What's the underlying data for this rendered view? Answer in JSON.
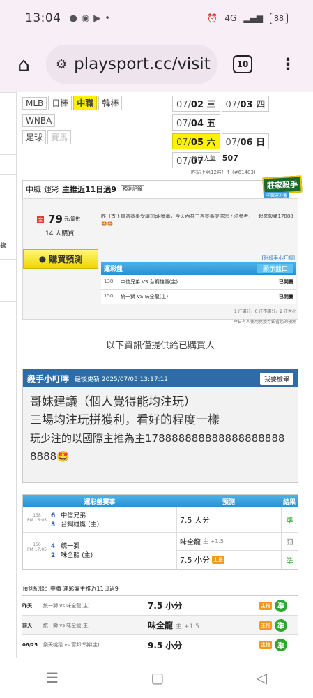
{
  "status": {
    "time": "13:04",
    "battery": "88",
    "net": "4G"
  },
  "browser": {
    "url": "playsport.cc/visit",
    "tab_count": "10"
  },
  "leagues": {
    "row1": [
      "MLB",
      "日棒",
      "中職",
      "韓棒"
    ],
    "row2": [
      "WNBA"
    ],
    "row3": [
      "足球",
      "賽馬"
    ],
    "active": "中職"
  },
  "dates": [
    {
      "m": "07/",
      "d": "02 三"
    },
    {
      "m": "07/",
      "d": "03 四"
    },
    {
      "m": "07/",
      "d": "04 五"
    },
    {
      "m": "07/",
      "d": "05 六"
    },
    {
      "m": "07/",
      "d": "06 日"
    },
    {
      "m": "07/",
      "d": "07 一"
    }
  ],
  "visits": {
    "label": "今日人氣",
    "value": "507",
    "sub": "昨站上第12名！↑ (#61483)"
  },
  "card": {
    "league": "中職",
    "type": "運彩",
    "title": "主推近11日過9",
    "record_btn": "預測記錄",
    "badge": "莊家殺手",
    "badge_sub": "中職運彩盤",
    "price_num": "79",
    "price_unit": "元/篇數",
    "buyers": "14",
    "buyers_unit": "人購買",
    "desc": "昨日首下單週賽事受讓加pk獲贏，今天內共三週賽事提供您下注參考，一起來殺豬17888🤩🤩",
    "buy_btn": "購買預測",
    "pm_link": "[附殺手小叮嚀]",
    "mini_header": "運彩盤",
    "mini_btn": "顯示盤口",
    "mini_rows": [
      {
        "no": "138",
        "match": "中信兄弟 VS 台鋼雄鷹(主)",
        "status": "已開賽"
      },
      {
        "no": "150",
        "match": "統一獅 VS 味全龍(主)",
        "status": "已開賽"
      }
    ],
    "mini_note": "1 注讓分，0 注不讓分，2 注大小",
    "mini_note2": "今日有人使用兌換券觀看您的預測"
  },
  "notice": "以下資訊僅提供給已購買人",
  "tips": {
    "title": "殺手小叮嚀",
    "updated": "最後更新 2025/07/05 13:17:12",
    "report_btn": "我要檢舉",
    "lines": [
      "哥妹建議（個人覺得能均注玩）",
      "三場均注玩拼獲利，看好的程度一樣",
      "玩少注的以國際主推為主1788888888888888888888888🤩"
    ]
  },
  "games_table": {
    "headers": [
      "運彩盤賽事",
      "預測",
      "結果"
    ],
    "rows": [
      {
        "no": "138",
        "time": "PM 16:05",
        "s1": "6",
        "t1": "中信兄弟",
        "s2": "3",
        "t2": "台鋼雄鷹 (主)",
        "pick": "7.5 大分",
        "result": "準"
      },
      {
        "no": "150",
        "time": "PM 17:05",
        "s1": "4",
        "t1": "統一獅",
        "s2": "2",
        "t2": "味全龍 (主)",
        "pick": "味全龍",
        "pick_sub": "主 +1.5",
        "result": "囧",
        "pick2": "7.5 小分",
        "result2": "準"
      }
    ]
  },
  "history": {
    "title": "預測紀錄：中職 運彩盤主推近11日過9",
    "rows": [
      {
        "day": "昨天",
        "match": "統一獅 vs 味全龍(主)",
        "pick": "7.5 小分",
        "sub": "",
        "res": "準"
      },
      {
        "day": "前天",
        "match": "統一獅 vs 味全龍(主)",
        "pick": "味全龍",
        "sub": "主 +1.5",
        "res": "準"
      },
      {
        "day": "06/25",
        "match": "樂天桃猿 vs 富邦悍將(主)",
        "pick": "9.5 小分",
        "sub": "",
        "res": "準"
      }
    ]
  }
}
